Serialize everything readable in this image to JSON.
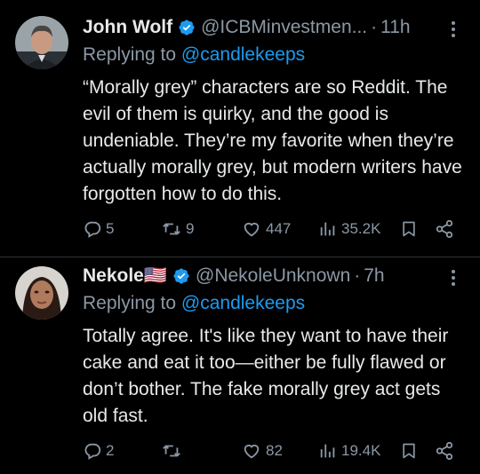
{
  "tweets": [
    {
      "name": "John Wolf",
      "handle": "@ICBMinvestmen...",
      "dot": "·",
      "time": "11h",
      "replying_prefix": "Replying to ",
      "replying_to": "@candlekeeps",
      "text": "“Morally grey” characters are so Reddit. The evil of them is quirky, and the good is undeniable. They’re my favorite when they’re actually morally grey, but modern writers have forgotten how to do this.",
      "replies": "5",
      "reposts": "9",
      "likes": "447",
      "views": "35.2K"
    },
    {
      "name": "Nekole🇺🇸",
      "handle": "@NekoleUnknown",
      "dot": "·",
      "time": "7h",
      "replying_prefix": "Replying to ",
      "replying_to": "@candlekeeps",
      "text": "Totally agree. It's like they want to have their cake and eat it too—either be fully flawed or don’t bother. The fake morally grey act gets old fast.",
      "replies": "2",
      "reposts": "",
      "likes": "82",
      "views": "19.4K"
    }
  ],
  "icons": [
    "verified-badge-icon",
    "more-icon",
    "reply-icon",
    "repost-icon",
    "like-icon",
    "views-icon",
    "bookmark-icon",
    "share-icon"
  ],
  "colors": {
    "background": "#000000",
    "text": "#e7e9ea",
    "muted": "#8b98a5",
    "accent": "#1d9bf0"
  }
}
